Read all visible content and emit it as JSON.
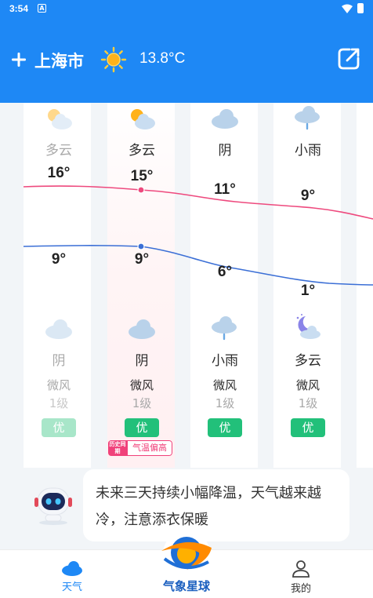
{
  "status_bar": {
    "time": "3:54",
    "notif_glyph": "A"
  },
  "header": {
    "city": "上海市",
    "current_temp": "13.8°C",
    "weather_icon": "sun-icon",
    "add_icon": "plus-icon",
    "share_icon": "share-icon"
  },
  "days": [
    {
      "day_weather": "多云",
      "day_icon": "partly-cloudy-icon",
      "high": "16°",
      "low": "9°",
      "night_weather": "阴",
      "night_icon": "cloud-icon",
      "wind": "微风",
      "wind_level": "1级",
      "aqi": "优",
      "past": true
    },
    {
      "day_weather": "多云",
      "day_icon": "partly-cloudy-icon",
      "high": "15°",
      "low": "9°",
      "night_weather": "阴",
      "night_icon": "cloud-icon",
      "wind": "微风",
      "wind_level": "1级",
      "aqi": "优",
      "past": false
    },
    {
      "day_weather": "阴",
      "day_icon": "cloud-icon",
      "high": "11°",
      "low": "6°",
      "night_weather": "小雨",
      "night_icon": "light-rain-icon",
      "wind": "微风",
      "wind_level": "1级",
      "aqi": "优",
      "past": false
    },
    {
      "day_weather": "小雨",
      "day_icon": "light-rain-icon",
      "high": "9°",
      "low": "1°",
      "night_weather": "多云",
      "night_icon": "cloudy-night-icon",
      "wind": "微风",
      "wind_level": "1级",
      "aqi": "优",
      "past": false
    }
  ],
  "history_badge": {
    "left": "历史同期",
    "right": "气温偏高"
  },
  "tip": {
    "text": "未来三天持续小幅降温，天气越来越冷，注意添衣保暖"
  },
  "bottom_nav": {
    "weather_label": "天气",
    "logo_text": "气象星球",
    "mine_label": "我的"
  },
  "colors": {
    "brand": "#1e88f5",
    "high_line": "#ee4a7e",
    "low_line": "#3b6fd6",
    "aqi_good": "#22c07a"
  }
}
